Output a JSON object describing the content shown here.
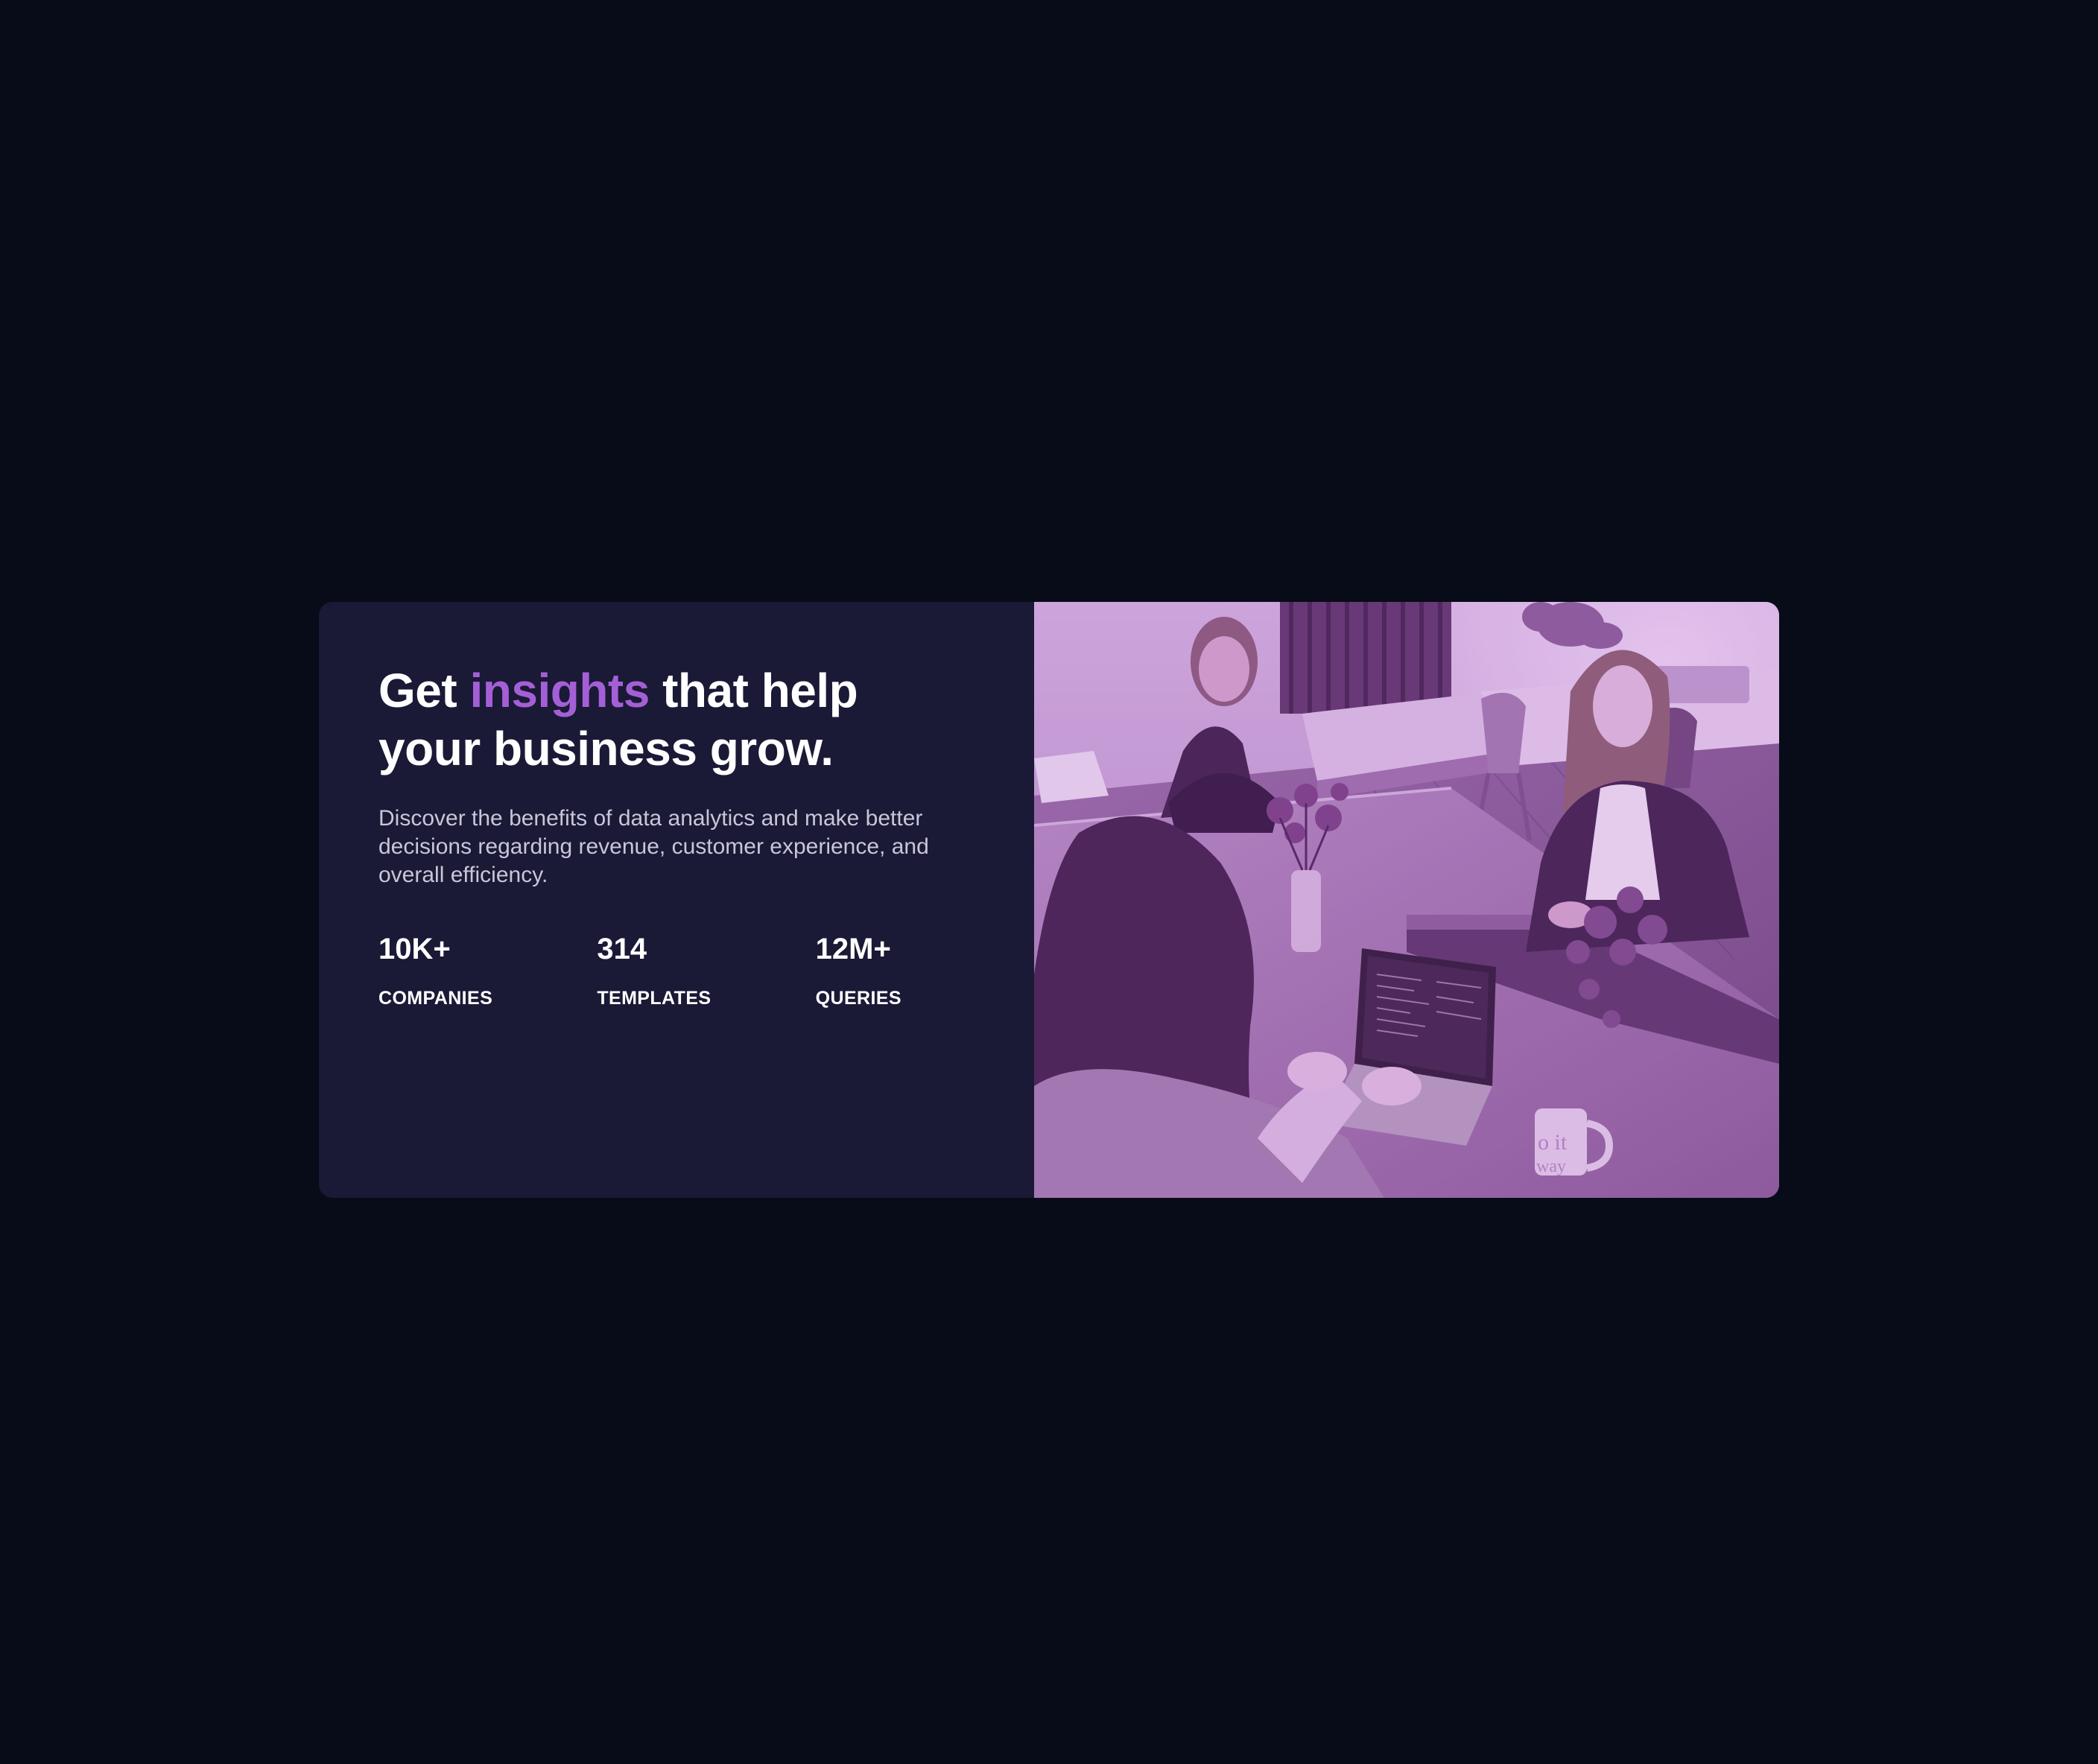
{
  "hero": {
    "title_before": "Get ",
    "title_accent": "insights",
    "title_after": " that help your business grow.",
    "description": "Discover the benefits of data analytics and make better decisions regarding revenue, customer experience, and overall efficiency.",
    "accent_color": "#a45fd6"
  },
  "stats": [
    {
      "value": "10K+",
      "label": "COMPANIES"
    },
    {
      "value": "314",
      "label": "TEMPLATES"
    },
    {
      "value": "12M+",
      "label": "QUERIES"
    }
  ],
  "photo": {
    "subject": "team-working-at-table-image",
    "mug_text": "o it",
    "mug_text_2": "way"
  }
}
